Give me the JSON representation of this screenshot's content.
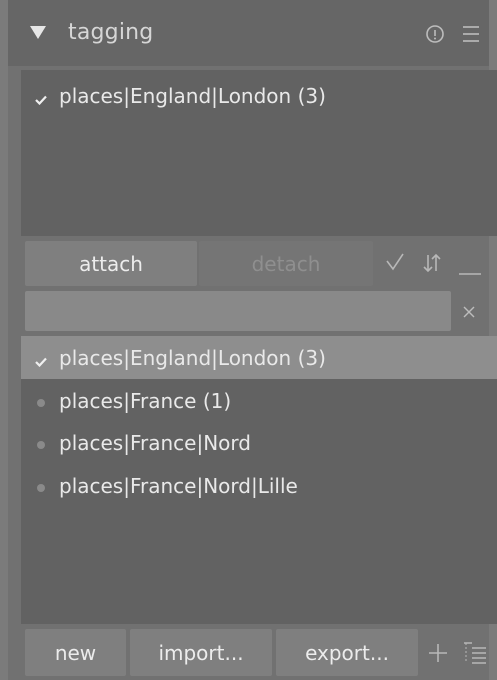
{
  "module": {
    "title": "tagging",
    "icons": [
      "expand-triangle-icon",
      "info-icon",
      "menu-icon"
    ]
  },
  "attached": {
    "items": [
      {
        "label": "places|England|London (3)",
        "checked": true
      }
    ]
  },
  "toolbar": {
    "attach_label": "attach",
    "detach_label": "detach",
    "icons": [
      "toggle-check-icon",
      "sort-icon",
      "hide-icon"
    ]
  },
  "search": {
    "value": "",
    "placeholder": ""
  },
  "dictionary": {
    "items": [
      {
        "label": "places|England|London (3)",
        "checked": true,
        "selected": true
      },
      {
        "label": "places|France (1)",
        "checked": false,
        "selected": false
      },
      {
        "label": "places|France|Nord",
        "checked": false,
        "selected": false
      },
      {
        "label": "places|France|Nord|Lille",
        "checked": false,
        "selected": false
      }
    ]
  },
  "footer": {
    "new_label": "new",
    "import_label": "import...",
    "export_label": "export...",
    "icons": [
      "plus-icon",
      "tree-view-icon"
    ]
  },
  "colors": {
    "panel_bg": "#717171",
    "header_bg": "#666666",
    "list_bg": "#626262",
    "selected_row": "#8e8e8e",
    "button_bg": "#7f7f7f",
    "text": "#e9e9e9",
    "disabled_text": "#8f8f8f"
  }
}
